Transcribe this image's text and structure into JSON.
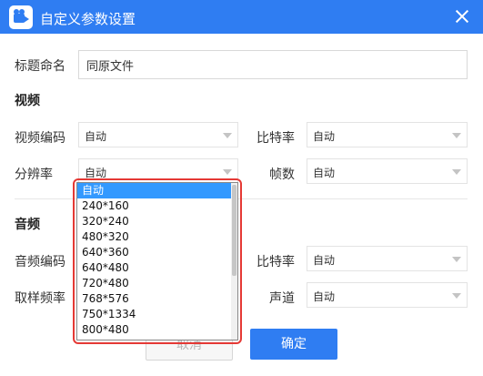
{
  "window": {
    "title": "自定义参数设置",
    "close_icon": "close-icon"
  },
  "form": {
    "title_label": "标题命名",
    "title_value": "同原文件"
  },
  "video": {
    "section_label": "视频",
    "codec_label": "视频编码",
    "codec_value": "自动",
    "bitrate_label": "比特率",
    "bitrate_value": "自动",
    "resolution_label": "分辨率",
    "resolution_value": "自动",
    "fps_label": "帧数",
    "fps_value": "自动"
  },
  "audio": {
    "section_label": "音频",
    "codec_label": "音频编码",
    "bitrate_label": "比特率",
    "bitrate_value": "自动",
    "samplerate_label": "取样频率",
    "channel_label": "声道",
    "channel_value": "自动"
  },
  "resolution_dropdown": {
    "options": [
      "自动",
      "240*160",
      "320*240",
      "480*320",
      "640*360",
      "640*480",
      "720*480",
      "768*576",
      "750*1334",
      "800*480"
    ],
    "selected_index": 0
  },
  "buttons": {
    "cancel": "取消",
    "ok": "确定"
  },
  "colors": {
    "accent": "#2f7df2",
    "highlight_border": "#e53935",
    "selected_option": "#3399ff"
  }
}
